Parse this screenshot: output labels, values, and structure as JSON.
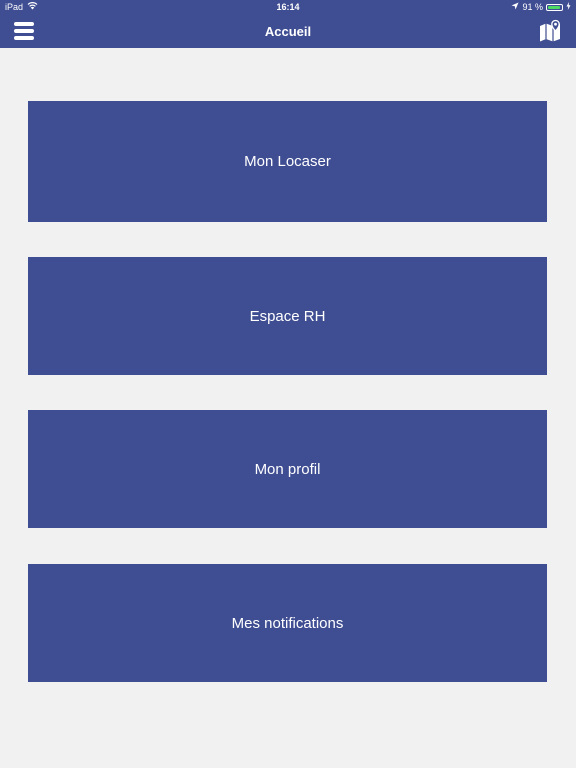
{
  "status_bar": {
    "device": "iPad",
    "time": "16:14",
    "battery": "91 %",
    "battery_level": 0.91,
    "icons": [
      "wifi-icon",
      "location-arrow-icon",
      "battery-icon",
      "charging-icon"
    ]
  },
  "nav": {
    "title": "Accueil",
    "left_icon": "hamburger-menu-icon",
    "right_icon": "map-pin-icon"
  },
  "menu": {
    "items": [
      {
        "label": "Mon Locaser"
      },
      {
        "label": "Espace RH"
      },
      {
        "label": "Mon profil"
      },
      {
        "label": "Mes notifications"
      }
    ]
  },
  "colors": {
    "primary": "#3f4d92",
    "background": "#f1f1f1",
    "text_on_primary": "#ffffff",
    "battery": "#4cd964"
  }
}
